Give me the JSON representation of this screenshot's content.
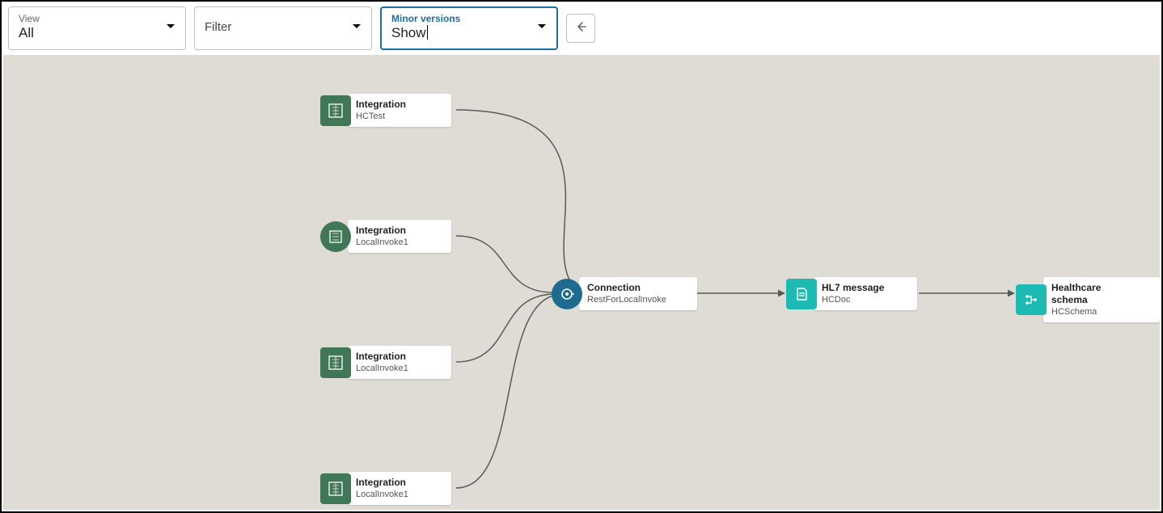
{
  "toolbar": {
    "view": {
      "label": "View",
      "value": "All"
    },
    "filter": {
      "label": "Filter"
    },
    "minor_versions": {
      "label": "Minor versions",
      "value": "Show"
    }
  },
  "nodes": {
    "n1": {
      "type": "Integration",
      "name": "HCTest"
    },
    "n2": {
      "type": "Integration",
      "name": "LocalInvoke1"
    },
    "n3": {
      "type": "Integration",
      "name": "LocalInvoke1"
    },
    "n4": {
      "type": "Integration",
      "name": "LocalInvoke1"
    },
    "conn": {
      "type": "Connection",
      "name": "RestForLocalInvoke"
    },
    "hl7": {
      "type": "HL7 message",
      "name": "HCDoc"
    },
    "schema": {
      "type": "Healthcare schema",
      "name": "HCSchema"
    }
  }
}
